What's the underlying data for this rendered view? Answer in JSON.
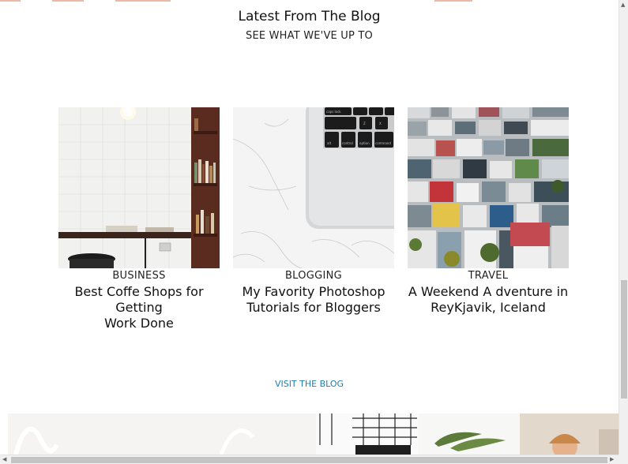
{
  "blog": {
    "title": "Latest From The Blog",
    "subtitle": "SEE WHAT WE'VE UP TO",
    "visit_label": "VISIT THE BLOG",
    "posts": [
      {
        "category": "BUSINESS",
        "title_lines": [
          "Best Coffe Shops for",
          "Getting",
          "Work Done"
        ]
      },
      {
        "category": "BLOGGING",
        "title_lines": [
          "My Favority Photoshop",
          "Tutorials for Bloggers"
        ]
      },
      {
        "category": "TRAVEL",
        "title_lines": [
          "A Weekend A dventure in",
          "ReyKjavik, Iceland"
        ]
      }
    ]
  },
  "keyboard_keys": [
    "caps lock",
    "Z",
    "X",
    "alt",
    "control",
    "option",
    "command"
  ],
  "colors": {
    "accent_peach": "#e9b9a3",
    "link_blue": "#1e7fb0"
  },
  "scrollbars": {
    "vertical_position": 0.62,
    "horizontal_position": 0.0
  }
}
